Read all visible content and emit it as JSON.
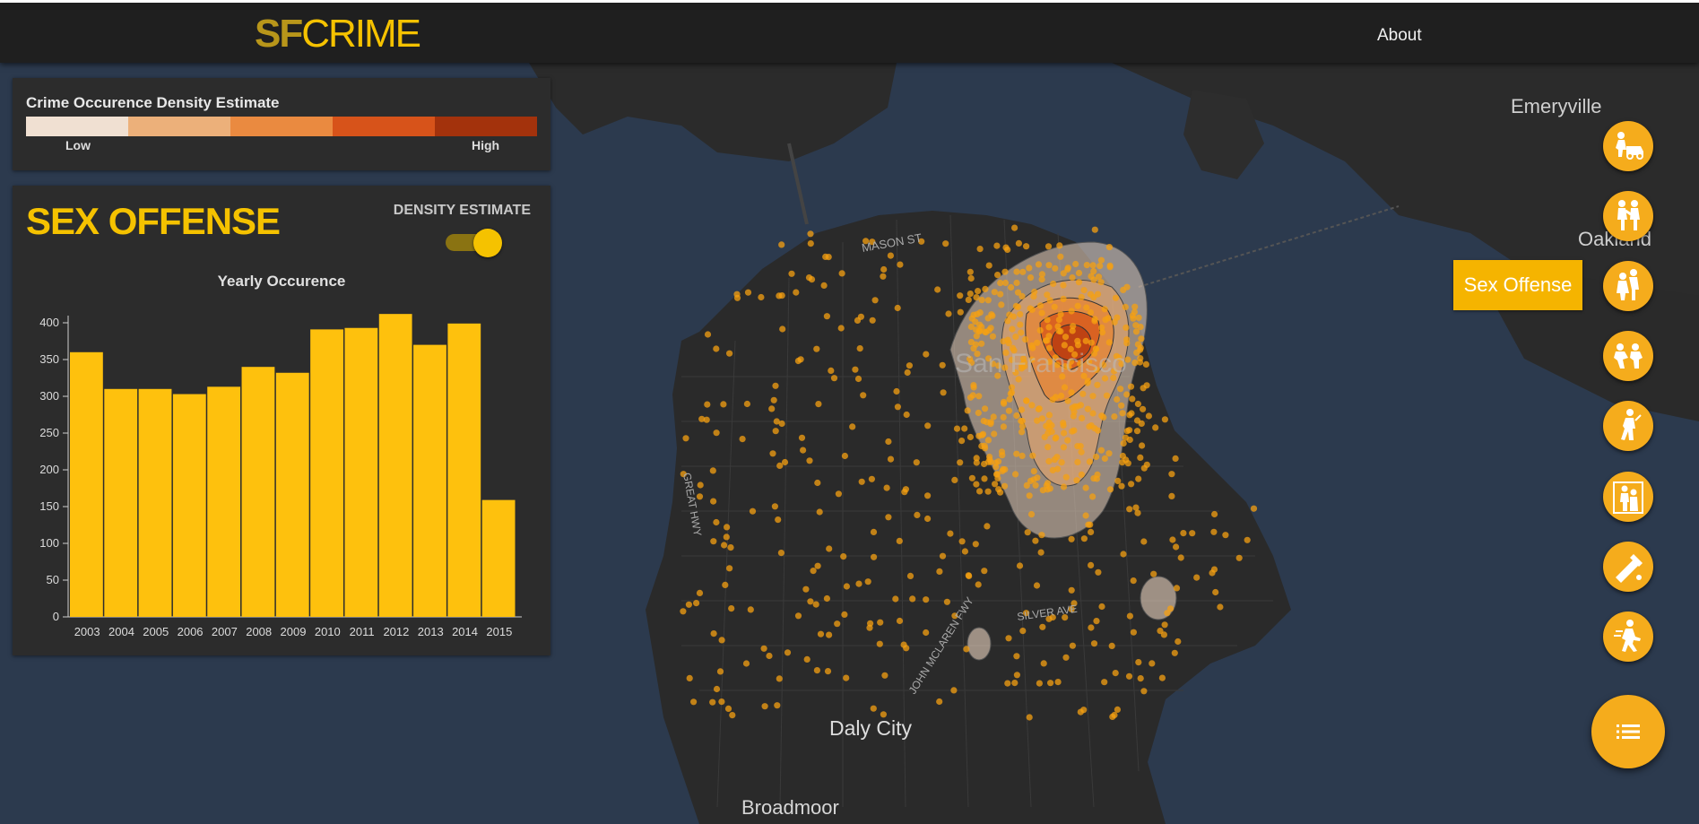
{
  "header": {
    "logo_sf": "SF",
    "logo_crime": "CRIME",
    "about_label": "About"
  },
  "legend": {
    "title": "Crime Occurence Density Estimate",
    "low_label": "Low",
    "high_label": "High",
    "colors": [
      "#f0e0d2",
      "#ecb07a",
      "#ea8a40",
      "#d7531a",
      "#a3320c"
    ]
  },
  "crime_panel": {
    "crime_title": "SEX OFFENSE",
    "density_toggle_label": "DENSITY ESTIMATE",
    "density_toggle_on": true
  },
  "chart_data": {
    "type": "bar",
    "title": "Yearly Occurence",
    "categories": [
      "2003",
      "2004",
      "2005",
      "2006",
      "2007",
      "2008",
      "2009",
      "2010",
      "2011",
      "2012",
      "2013",
      "2014",
      "2015"
    ],
    "values": [
      360,
      310,
      310,
      303,
      313,
      340,
      332,
      391,
      393,
      412,
      370,
      399,
      159
    ],
    "ylim": [
      0,
      400
    ],
    "yticks": [
      0,
      50,
      100,
      150,
      200,
      250,
      300,
      350,
      400
    ],
    "bar_color": "#fec10d"
  },
  "map": {
    "labels": {
      "emeryville": "Emeryville",
      "oakland": "Oakland",
      "daly_city": "Daly City",
      "broadmoor": "Broadmoor",
      "san_francisco": "San Francisco",
      "mason_st": "MASON ST",
      "great_hwy": "GREAT HWY",
      "silver_ave": "SILVER AVE",
      "john_mclaren": "JOHN MCLAREN FWY"
    },
    "water_color": "#2c3a4e",
    "land_color": "#2a2a2a",
    "point_color": "#f5a011"
  },
  "categories": {
    "buttons": [
      {
        "name": "vehicle-theft",
        "icon": "car-thief-icon"
      },
      {
        "name": "assault",
        "icon": "assault-icon"
      },
      {
        "name": "sex-offense",
        "icon": "sex-offense-icon"
      },
      {
        "name": "robbery",
        "icon": "robbery-icon"
      },
      {
        "name": "drug",
        "icon": "drug-icon"
      },
      {
        "name": "burglary",
        "icon": "burglary-icon"
      },
      {
        "name": "vandalism",
        "icon": "vandalism-icon"
      },
      {
        "name": "larceny",
        "icon": "runner-icon"
      }
    ],
    "tooltip": "Sex Offense",
    "menu_icon": "list-icon"
  }
}
